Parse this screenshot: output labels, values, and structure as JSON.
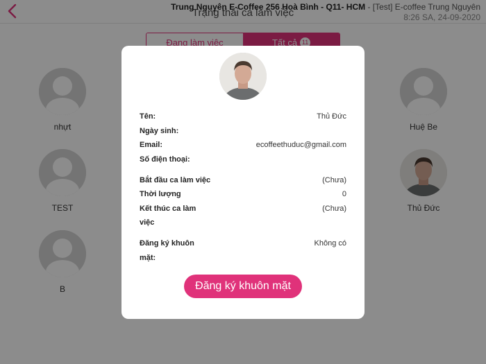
{
  "header": {
    "title": "Trạng thái ca làm việc",
    "store_bold": "Trung Nguyên E-Coffee 256 Hoà Bình - Q11- HCM",
    "store_rest": " - [Test] E-coffee Trung Nguyên",
    "datetime": "8:26 SA, 24-09-2020"
  },
  "tabs": {
    "working": "Đang làm việc",
    "all": "Tất cả",
    "all_count": "11"
  },
  "employees": {
    "e1": "nhựt",
    "e2": "TEST",
    "e3": "B",
    "e4": "Huệ Be",
    "e5": "Thủ Đức"
  },
  "modal": {
    "name_label": "Tên:",
    "name_value": "Thủ Đức",
    "dob_label": "Ngày sinh:",
    "dob_value": "",
    "email_label": "Email:",
    "email_value": "ecoffeethuduc@gmail.com",
    "phone_label": "Số điện thoại:",
    "phone_value": "",
    "start_label": "Bắt đầu ca làm việc",
    "start_value": "(Chưa)",
    "duration_label": "Thời lượng",
    "duration_value": "0",
    "end_label_1": "Kết thúc ca làm",
    "end_label_2": "việc",
    "end_value": "(Chưa)",
    "face_label_1": "Đăng ký khuôn",
    "face_label_2": "mặt:",
    "face_value": "Không có",
    "register_button": "Đăng ký khuôn mặt"
  },
  "colors": {
    "accent": "#e0327a"
  }
}
